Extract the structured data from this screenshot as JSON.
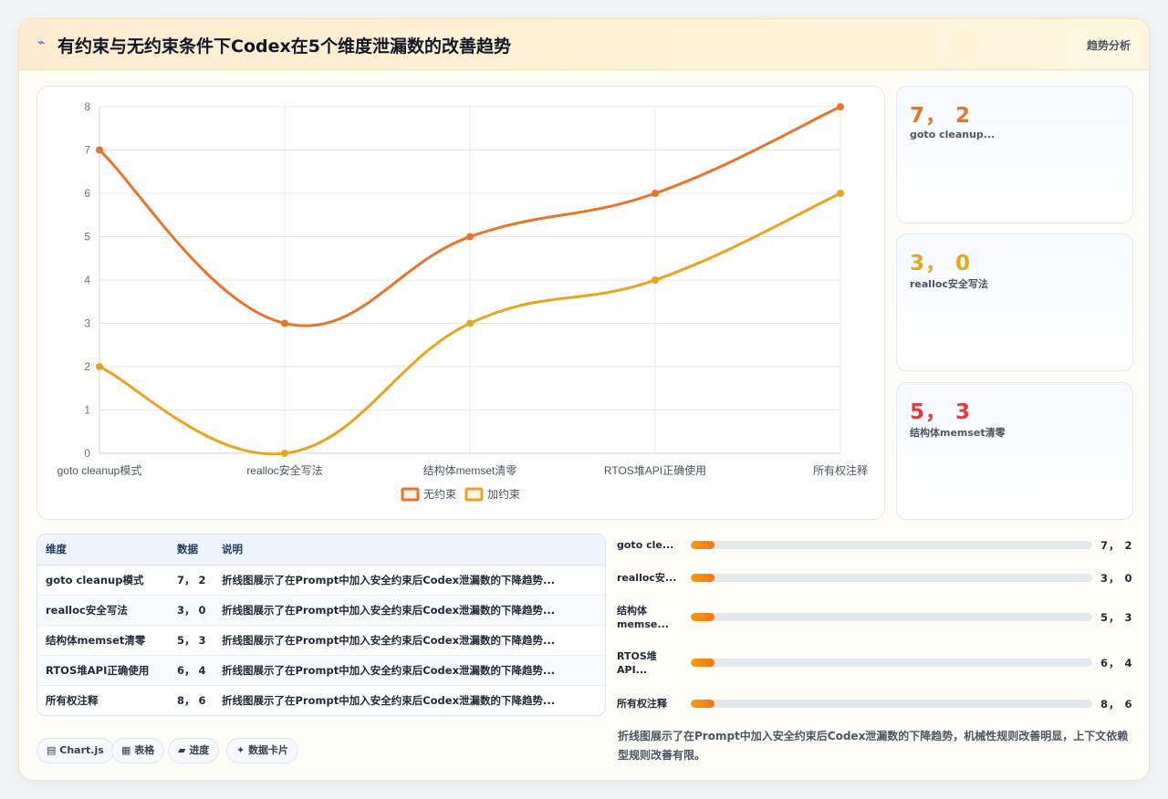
{
  "header": {
    "title": "有约束与无约束条件下Codex在5个维度泄漏数的改善趋势",
    "tag": "趋势分析",
    "icon": "pulse-icon"
  },
  "chart_data": {
    "type": "line",
    "categories": [
      "goto cleanup模式",
      "realloc安全写法",
      "结构体memset清零",
      "RTOS堆API正确使用",
      "所有权注释"
    ],
    "series": [
      {
        "name": "无约束",
        "values": [
          7,
          3,
          5,
          6,
          8
        ],
        "color": "#e8742a"
      },
      {
        "name": "加约束",
        "values": [
          2,
          0,
          3,
          4,
          6
        ],
        "color": "#e9a41f"
      }
    ],
    "ylim": [
      0,
      8
    ],
    "yticks": [
      0,
      1,
      2,
      3,
      4,
      5,
      6,
      7,
      8
    ],
    "grid": true,
    "legend": "bottom"
  },
  "stats": [
    {
      "value": "7， 2",
      "label": "goto cleanup...",
      "color": "#e8742a"
    },
    {
      "value": "3， 0",
      "label": "realloc安全写法",
      "color": "#e9a41f"
    },
    {
      "value": "5， 3",
      "label": "结构体memset清零",
      "color": "#e23b3b"
    }
  ],
  "table": {
    "headers": [
      "维度",
      "数据",
      "说明"
    ],
    "rows": [
      [
        "goto cleanup模式",
        "7， 2",
        "折线图展示了在Prompt中加入安全约束后Codex泄漏数的下降趋势..."
      ],
      [
        "realloc安全写法",
        "3， 0",
        "折线图展示了在Prompt中加入安全约束后Codex泄漏数的下降趋势..."
      ],
      [
        "结构体memset清零",
        "5， 3",
        "折线图展示了在Prompt中加入安全约束后Codex泄漏数的下降趋势..."
      ],
      [
        "RTOS堆API正确使用",
        "6， 4",
        "折线图展示了在Prompt中加入安全约束后Codex泄漏数的下降趋势..."
      ],
      [
        "所有权注释",
        "8， 6",
        "折线图展示了在Prompt中加入安全约束后Codex泄漏数的下降趋势..."
      ]
    ]
  },
  "progress": [
    {
      "label": "goto cle...",
      "value": "7， 2",
      "fill": 0.06
    },
    {
      "label": "realloc安...",
      "value": "3， 0",
      "fill": 0.06
    },
    {
      "label": "结构体memse...",
      "value": "5， 3",
      "fill": 0.06
    },
    {
      "label": "RTOS堆API...",
      "value": "6， 4",
      "fill": 0.06
    },
    {
      "label": "所有权注释",
      "value": "8， 6",
      "fill": 0.06
    }
  ],
  "chips": [
    {
      "icon": "chart-icon",
      "glyph": "▤",
      "label": "Chart.js"
    },
    {
      "icon": "table-icon",
      "glyph": "▦",
      "label": "表格"
    },
    {
      "icon": "progress-icon",
      "glyph": "▰",
      "label": "进度"
    },
    {
      "icon": "card-icon",
      "glyph": "✦",
      "label": "数据卡片"
    }
  ],
  "summary": "折线图展示了在Prompt中加入安全约束后Codex泄漏数的下降趋势，机械性规则改善明显，上下文依赖型规则改善有限。"
}
